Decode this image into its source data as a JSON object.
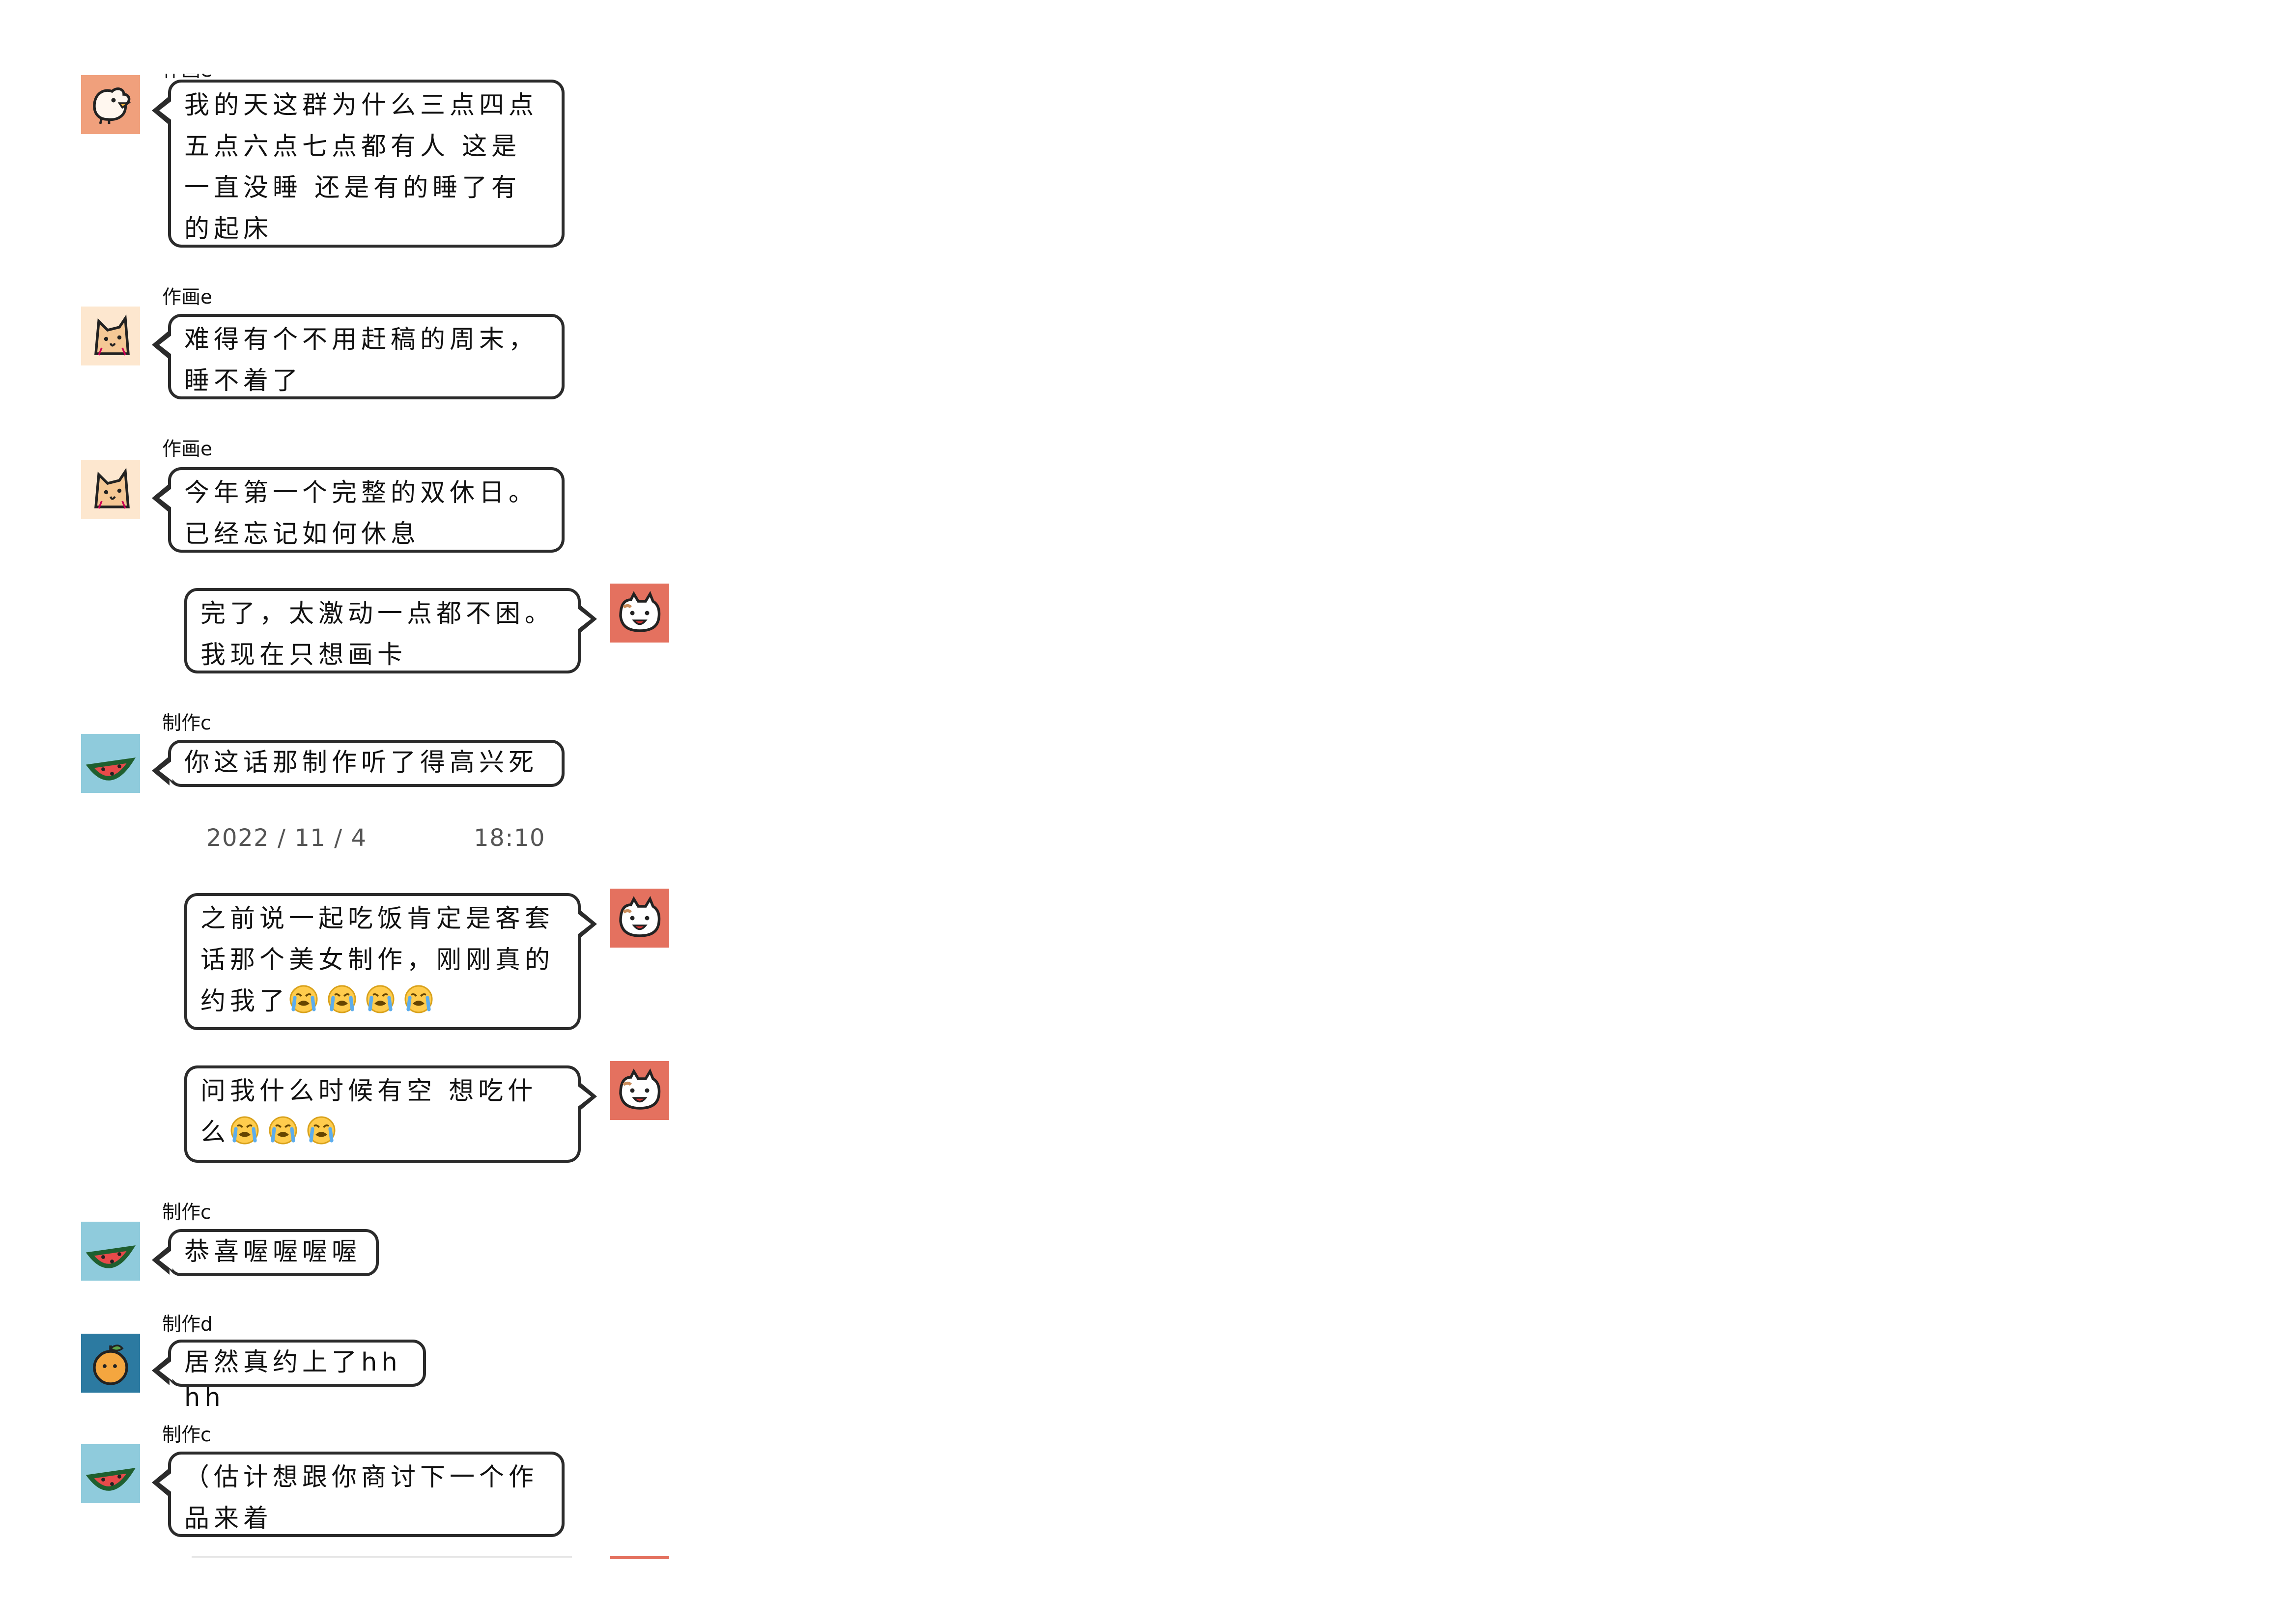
{
  "messages": [
    {
      "id": "m1",
      "side": "left",
      "sender": "作画e",
      "avatar": "chick-icon",
      "text": "我的天这群为什么三点四点五点六点七点都有人 这是一直没睡 还是有的睡了有的起床"
    },
    {
      "id": "m2",
      "side": "left",
      "sender": "作画e",
      "avatar": "cat-icon",
      "text": "难得有个不用赶稿的周末，睡不着了"
    },
    {
      "id": "m3",
      "side": "left",
      "sender": "作画e",
      "avatar": "cat-icon",
      "text": "今年第一个完整的双休日。已经忘记如何休息"
    },
    {
      "id": "m4",
      "side": "right",
      "sender": "",
      "avatar": "grinning-cat-icon",
      "text": "完了，太激动一点都不困。我现在只想画卡"
    },
    {
      "id": "m5",
      "side": "left",
      "sender": "制作c",
      "avatar": "watermelon-icon",
      "text": "你这话那制作听了得高兴死"
    },
    {
      "id": "m6",
      "side": "right",
      "sender": "",
      "avatar": "grinning-cat-icon",
      "text": "之前说一起吃饭肯定是客套话那个美女制作，刚刚真的约我了",
      "emoji_count": 4,
      "emoji": "loudly-crying-face-icon"
    },
    {
      "id": "m7",
      "side": "right",
      "sender": "",
      "avatar": "grinning-cat-icon",
      "text": "问我什么时候有空 想吃什么",
      "emoji_count": 3,
      "emoji": "loudly-crying-face-icon"
    },
    {
      "id": "m8",
      "side": "left",
      "sender": "制作c",
      "avatar": "watermelon-icon",
      "text": "恭喜喔喔喔喔"
    },
    {
      "id": "m9",
      "side": "left",
      "sender": "制作d",
      "avatar": "orange-icon",
      "text": "居然真约上了hhhh"
    },
    {
      "id": "m10",
      "side": "left",
      "sender": "制作c",
      "avatar": "watermelon-icon",
      "text": "（估计想跟你商讨下一个作品来着"
    }
  ],
  "timestamp": {
    "date": "2022 / 11 / 4",
    "time": "18:10"
  },
  "colors": {
    "bubble_border": "#2b2b2b",
    "chick_bg": "#f0a07c",
    "cat_bg": "#fde7cf",
    "watermelon_bg": "#8fcbdc",
    "orange_bg": "#2c7aa1",
    "me_bg": "#e4715f"
  }
}
